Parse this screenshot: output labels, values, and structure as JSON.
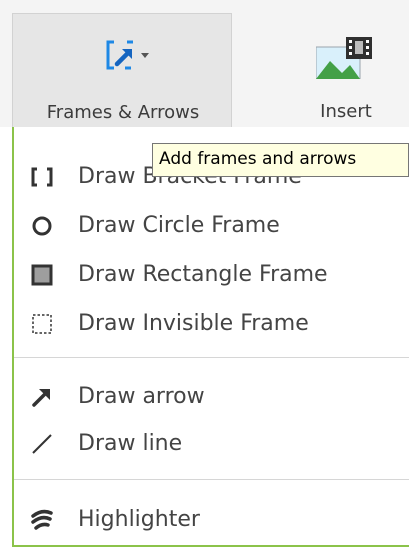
{
  "ribbon": {
    "frames_button": {
      "label": "Frames & Arrows",
      "icon": "frame-arrow-icon"
    },
    "insert_button": {
      "label": "Insert",
      "icon": "insert-image-icon"
    }
  },
  "tooltip": {
    "text": "Add frames and arrows"
  },
  "menu": {
    "items": [
      {
        "label": "Draw Bracket Frame",
        "icon": "bracket-frame-icon"
      },
      {
        "label": "Draw Circle Frame",
        "icon": "circle-frame-icon"
      },
      {
        "label": "Draw Rectangle Frame",
        "icon": "rectangle-frame-icon"
      },
      {
        "label": "Draw Invisible Frame",
        "icon": "invisible-frame-icon"
      },
      {
        "label": "Draw arrow",
        "icon": "arrow-icon"
      },
      {
        "label": "Draw line",
        "icon": "line-icon"
      },
      {
        "label": "Highlighter",
        "icon": "highlighter-icon"
      }
    ]
  },
  "colors": {
    "accent_green": "#8bc34a",
    "icon_blue": "#1e88e5",
    "tooltip_bg": "#ffffe1"
  }
}
